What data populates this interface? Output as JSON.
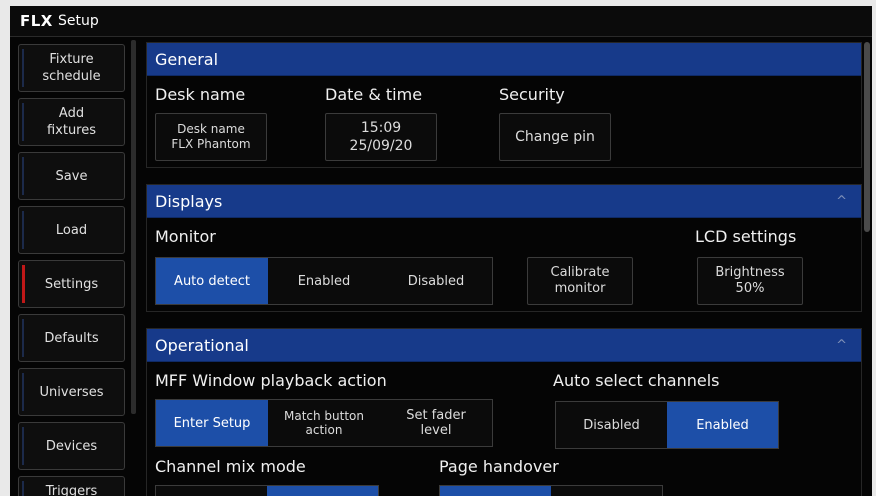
{
  "app": {
    "logo": "FLX",
    "title": "Setup"
  },
  "sidebar": {
    "items": [
      {
        "label": "Fixture\nschedule",
        "active": false
      },
      {
        "label": "Add\nfixtures",
        "active": false
      },
      {
        "label": "Save",
        "active": false
      },
      {
        "label": "Load",
        "active": false
      },
      {
        "label": "Settings",
        "active": true
      },
      {
        "label": "Defaults",
        "active": false
      },
      {
        "label": "Universes",
        "active": false
      },
      {
        "label": "Devices",
        "active": false
      },
      {
        "label": "Triggers",
        "active": false
      }
    ]
  },
  "general": {
    "header": "General",
    "desk_name_label": "Desk name",
    "desk_name_button": "Desk name\nFLX Phantom",
    "datetime_label": "Date & time",
    "datetime_button": "15:09\n25/09/20",
    "security_label": "Security",
    "change_pin_button": "Change pin"
  },
  "displays": {
    "header": "Displays",
    "caret": "^",
    "monitor_label": "Monitor",
    "monitor_options": [
      "Auto detect",
      "Enabled",
      "Disabled"
    ],
    "monitor_selected": "Auto detect",
    "calibrate_button": "Calibrate\nmonitor",
    "lcd_label": "LCD settings",
    "brightness_button": "Brightness\n50%"
  },
  "operational": {
    "header": "Operational",
    "caret": "^",
    "mff_label": "MFF Window playback action",
    "mff_options": [
      "Enter Setup",
      "Match button\naction",
      "Set fader\nlevel"
    ],
    "mff_selected": "Enter Setup",
    "auto_select_label": "Auto select channels",
    "auto_select_options": [
      "Disabled",
      "Enabled"
    ],
    "auto_select_selected": "Enabled",
    "channel_mix_label": "Channel mix mode",
    "page_handover_label": "Page handover"
  },
  "colors": {
    "accent": "#1d4fa8",
    "header": "#173a8a",
    "active_marker": "#c01818"
  }
}
